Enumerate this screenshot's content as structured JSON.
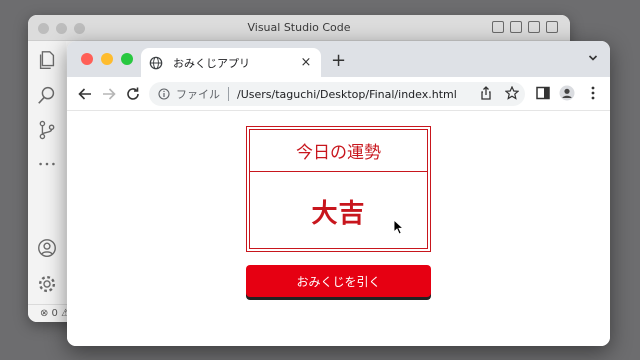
{
  "vscode": {
    "title": "Visual Studio Code",
    "status_text": "⊗ 0 ⚠"
  },
  "browser": {
    "tab_title": "おみくじアプリ",
    "tab_close": "×",
    "new_tab": "+",
    "address_label": "ファイル",
    "address_url": "/Users/taguchi/Desktop/Final/index.html"
  },
  "page": {
    "heading": "今日の運勢",
    "result": "大吉",
    "button_label": "おみくじを引く"
  },
  "colors": {
    "accent_red": "#c8161d",
    "button_red": "#e60012"
  }
}
